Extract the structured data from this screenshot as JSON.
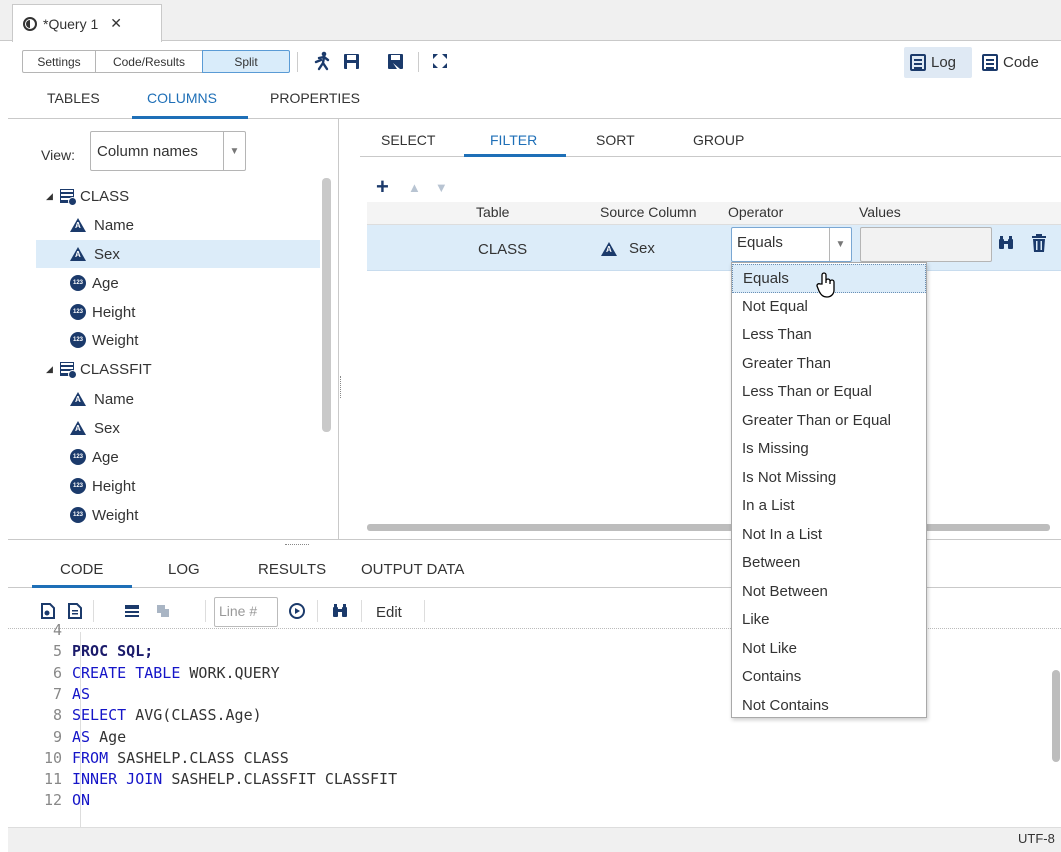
{
  "doc_tab": {
    "title": "*Query 1",
    "close": "✕"
  },
  "toolbar": {
    "settings": "Settings",
    "code_results": "Code/Results",
    "split": "Split",
    "log": "Log",
    "code": "Code"
  },
  "top_tabs": [
    "TABLES",
    "COLUMNS",
    "PROPERTIES"
  ],
  "view": {
    "label": "View:",
    "selected": "Column names"
  },
  "tree": [
    {
      "label": "CLASS",
      "type": "table"
    },
    {
      "label": "Name",
      "type": "char"
    },
    {
      "label": "Sex",
      "type": "char",
      "selected": true
    },
    {
      "label": "Age",
      "type": "num"
    },
    {
      "label": "Height",
      "type": "num"
    },
    {
      "label": "Weight",
      "type": "num"
    },
    {
      "label": "CLASSFIT",
      "type": "table"
    },
    {
      "label": "Name",
      "type": "char"
    },
    {
      "label": "Sex",
      "type": "char"
    },
    {
      "label": "Age",
      "type": "num"
    },
    {
      "label": "Height",
      "type": "num"
    },
    {
      "label": "Weight",
      "type": "num"
    }
  ],
  "sub_tabs": [
    "SELECT",
    "FILTER",
    "SORT",
    "GROUP"
  ],
  "filter_grid": {
    "headers": [
      "Table",
      "Source Column",
      "Operator",
      "Values"
    ],
    "row": {
      "table": "CLASS",
      "source": "Sex",
      "operator": "Equals",
      "value": ""
    }
  },
  "operator_options": [
    "Equals",
    "Not Equal",
    "Less Than",
    "Greater Than",
    "Less Than or Equal",
    "Greater Than or Equal",
    "Is Missing",
    "Is Not Missing",
    "In a List",
    "Not In a List",
    "Between",
    "Not Between",
    "Like",
    "Not Like",
    "Contains",
    "Not Contains"
  ],
  "bottom_tabs": [
    "CODE",
    "LOG",
    "RESULTS",
    "OUTPUT DATA"
  ],
  "editor": {
    "line_placeholder": "Line #",
    "edit": "Edit"
  },
  "code_lines": [
    {
      "n": "4",
      "parts": []
    },
    {
      "n": "5",
      "parts": [
        [
          "bold-kw",
          "PROC SQL;"
        ]
      ]
    },
    {
      "n": "6",
      "parts": [
        [
          "kw",
          "CREATE TABLE "
        ],
        [
          "plain",
          "WORK.QUERY"
        ]
      ]
    },
    {
      "n": "7",
      "parts": [
        [
          "kw",
          "AS"
        ]
      ]
    },
    {
      "n": "8",
      "parts": [
        [
          "kw",
          "SELECT "
        ],
        [
          "plain",
          "AVG(CLASS.Age)"
        ]
      ]
    },
    {
      "n": "9",
      "parts": [
        [
          "kw",
          "AS "
        ],
        [
          "plain",
          "Age"
        ]
      ]
    },
    {
      "n": "10",
      "parts": [
        [
          "kw",
          "FROM "
        ],
        [
          "plain",
          "SASHELP.CLASS CLASS"
        ]
      ]
    },
    {
      "n": "11",
      "parts": [
        [
          "kw",
          "INNER JOIN "
        ],
        [
          "plain",
          "SASHELP.CLASSFIT CLASSFIT"
        ]
      ]
    },
    {
      "n": "12",
      "parts": [
        [
          "kw",
          "ON"
        ]
      ]
    }
  ],
  "status": {
    "encoding": "UTF-8"
  },
  "icons": {
    "run": "running-man-icon",
    "save": "floppy-icon",
    "save_as": "floppy-as-icon",
    "maximize": "maximize-icon",
    "add": "plus-icon",
    "up": "arrow-up-icon",
    "down": "arrow-down-icon",
    "find": "binoculars-icon",
    "delete": "trash-icon"
  },
  "colors": {
    "accent": "#1e6fb7",
    "selection": "#dcecf9",
    "icon": "#1b3a6b",
    "keyword": "#1515c8"
  }
}
